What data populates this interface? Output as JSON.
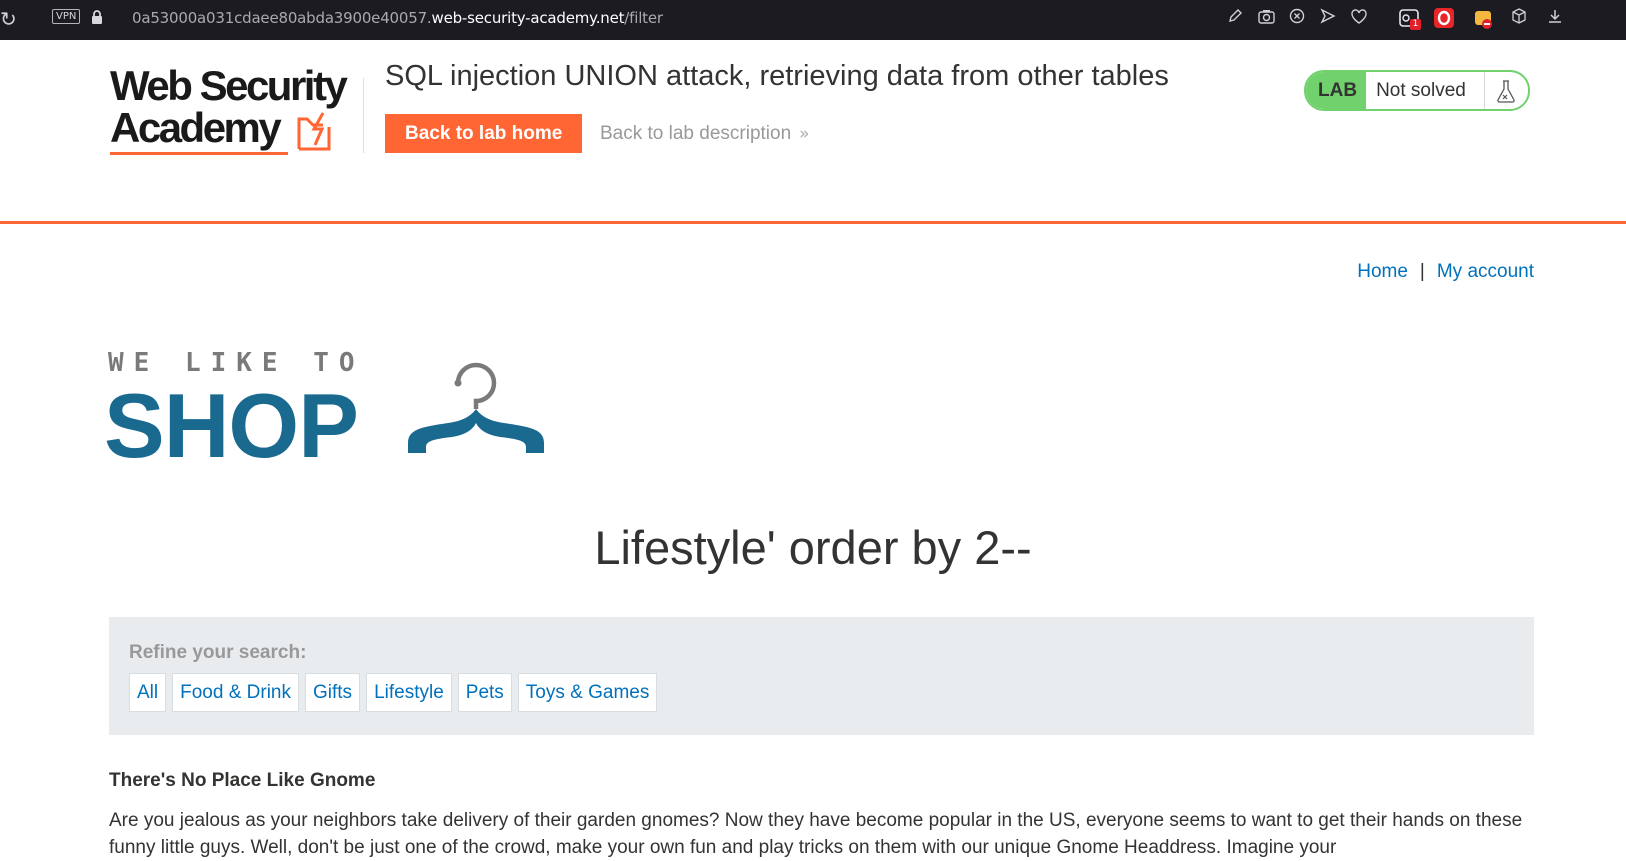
{
  "browser": {
    "vpn_label": "VPN",
    "url_prefix": "0a53000a031cdaee80abda3900e40057.",
    "url_domain": "web-security-academy.net",
    "url_path": "/filter",
    "extension_badge": "1",
    "icons": [
      "reload-icon",
      "lock-icon",
      "edit-icon",
      "camera-icon",
      "shield-icon",
      "send-icon",
      "heart-icon",
      "extension-icon",
      "opera-icon",
      "puzzle-icon",
      "box-icon",
      "download-icon"
    ]
  },
  "academy": {
    "logo_line1": "Web Security",
    "logo_line2": "Academy",
    "lab_title": "SQL injection UNION attack, retrieving data from other tables",
    "back_home_label": "Back to lab home",
    "back_desc_label": "Back to lab description",
    "lab_tag": "LAB",
    "lab_status": "Not solved",
    "accent_color": "#ff6633",
    "status_color": "#70d16d"
  },
  "shop": {
    "nav": {
      "home": "Home",
      "separator": "|",
      "account": "My account"
    },
    "logo_top": "WE LIKE TO",
    "logo_main": "SHOP",
    "heading": "Lifestyle' order by 2--",
    "refine_label": "Refine your search:",
    "categories": [
      "All",
      "Food & Drink",
      "Gifts",
      "Lifestyle",
      "Pets",
      "Toys & Games"
    ],
    "product": {
      "name": "There's No Place Like Gnome",
      "description": "Are you jealous as your neighbors take delivery of their garden gnomes? Now they have become popular in the US, everyone seems to want to get their hands on these funny little guys. Well, don't be just one of the crowd, make your own fun and play tricks on them with our unique Gnome Headdress. Imagine your"
    },
    "brand_color": "#1a6a90",
    "link_color": "#0071bc"
  }
}
